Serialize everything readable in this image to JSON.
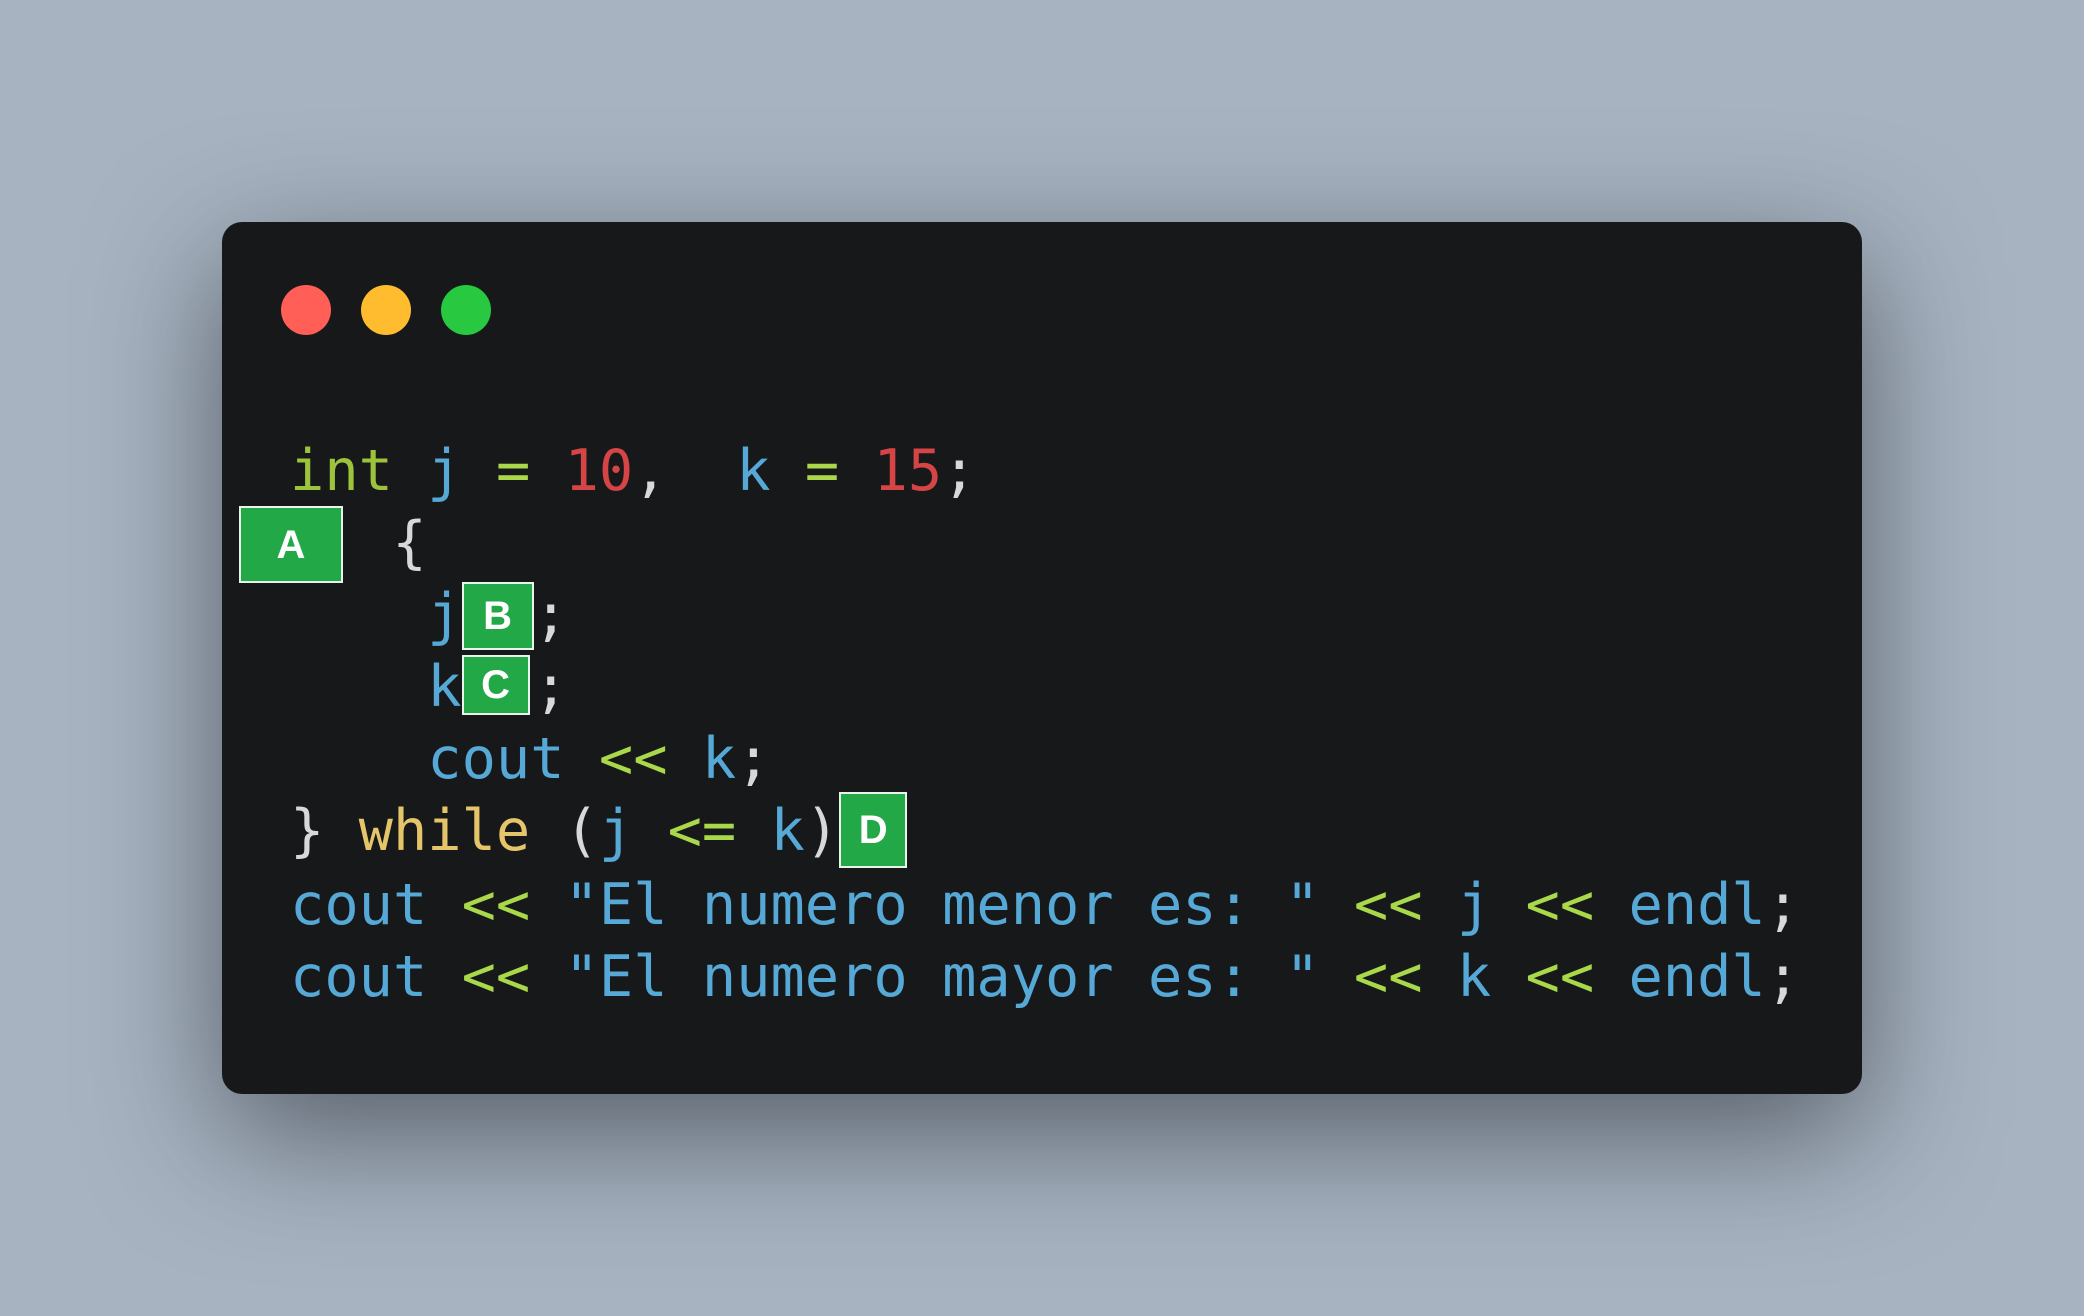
{
  "window": {
    "buttons": {
      "close_color": "#ff5f57",
      "minimize_color": "#febc2e",
      "maximize_color": "#28c840"
    }
  },
  "code": {
    "line1": {
      "type": "int",
      "var_j": "j",
      "eq1": "=",
      "val_j": "10",
      "comma": ",",
      "var_k": "k",
      "eq2": "=",
      "val_k": "15",
      "semi": ";"
    },
    "line2": {
      "blank": "A",
      "brace": "{"
    },
    "line3": {
      "var": "j",
      "blank": "B",
      "semi": ";"
    },
    "line4": {
      "var": "k",
      "blank": "C",
      "semi": ";"
    },
    "line5": {
      "cout": "cout",
      "op": "<<",
      "var": "k",
      "semi": ";"
    },
    "line6": {
      "brace": "}",
      "keyword": "while",
      "lparen": "(",
      "var_j": "j",
      "op": "<=",
      "var_k": "k",
      "rparen": ")",
      "blank": "D"
    },
    "line7": {
      "cout": "cout",
      "op1": "<<",
      "string": "\"El numero menor es: \"",
      "op2": "<<",
      "var": "j",
      "op3": "<<",
      "endl": "endl",
      "semi": ";"
    },
    "line8": {
      "cout": "cout",
      "op1": "<<",
      "string": "\"El numero mayor es: \"",
      "op2": "<<",
      "var": "k",
      "op3": "<<",
      "endl": "endl",
      "semi": ";"
    }
  },
  "colors": {
    "window_bg": "#17181a",
    "page_bg": "#a7b3c1",
    "badge_bg": "#22a846",
    "keyword": "#9dc23c",
    "identifier": "#56a8d6",
    "number": "#d64545",
    "operator": "#a9d84a",
    "control": "#e4c56a"
  }
}
